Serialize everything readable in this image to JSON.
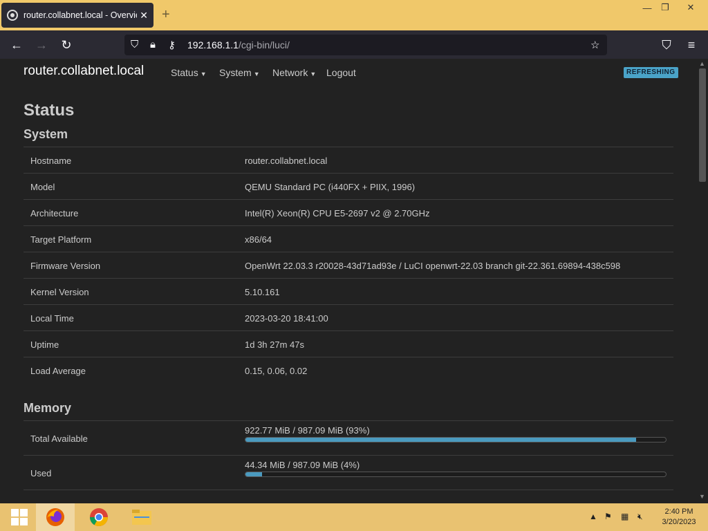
{
  "browser": {
    "tab_title": "router.collabnet.local - Overview",
    "tab_close": "✕",
    "new_tab": "+",
    "url_host": "192.168.1.1",
    "url_path": "/cgi-bin/luci/",
    "window_controls": {
      "minimize": "—",
      "restore": "❐",
      "close": "✕"
    }
  },
  "header": {
    "brand": "router.collabnet.local",
    "menu": [
      "Status",
      "System",
      "Network",
      "Logout"
    ],
    "badge": "REFRESHING",
    "badge_color": "#4aa3c8"
  },
  "page_title": "Status",
  "system": {
    "heading": "System",
    "rows": [
      {
        "key": "Hostname",
        "value": "router.collabnet.local"
      },
      {
        "key": "Model",
        "value": "QEMU Standard PC (i440FX + PIIX, 1996)"
      },
      {
        "key": "Architecture",
        "value": "Intel(R) Xeon(R) CPU E5-2697 v2 @ 2.70GHz"
      },
      {
        "key": "Target Platform",
        "value": "x86/64"
      },
      {
        "key": "Firmware Version",
        "value": "OpenWrt 22.03.3 r20028-43d71ad93e / LuCI openwrt-22.03 branch git-22.361.69894-438c598"
      },
      {
        "key": "Kernel Version",
        "value": "5.10.161"
      },
      {
        "key": "Local Time",
        "value": "2023-03-20 18:41:00"
      },
      {
        "key": "Uptime",
        "value": "1d 3h 27m 47s"
      },
      {
        "key": "Load Average",
        "value": "0.15, 0.06, 0.02"
      }
    ]
  },
  "memory": {
    "heading": "Memory",
    "rows": [
      {
        "key": "Total Available",
        "label": "922.77 MiB / 987.09 MiB (93%)",
        "percent": 93
      },
      {
        "key": "Used",
        "label": "44.34 MiB / 987.09 MiB (4%)",
        "percent": 4
      }
    ]
  },
  "taskbar": {
    "clock_time": "2:40 PM",
    "clock_date": "3/20/2023"
  },
  "accent_color": "#4a9abf"
}
